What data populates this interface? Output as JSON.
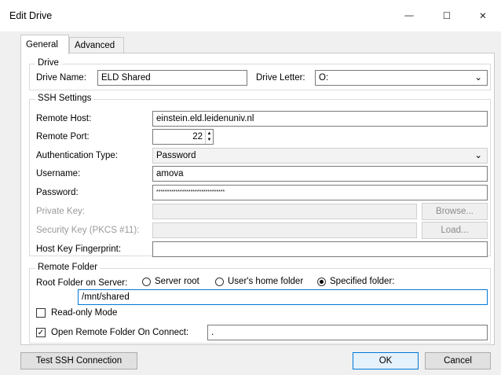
{
  "window": {
    "title": "Edit Drive",
    "minimize": "—",
    "maximize": "☐",
    "close": "✕"
  },
  "tabs": [
    {
      "label": "General"
    },
    {
      "label": "Advanced"
    }
  ],
  "drive": {
    "group_label": "Drive",
    "name_label": "Drive Name:",
    "name_value": "ELD Shared",
    "letter_label": "Drive Letter:",
    "letter_value": "O:"
  },
  "ssh": {
    "group_label": "SSH Settings",
    "host_label": "Remote Host:",
    "host_value": "einstein.eld.leidenuniv.nl",
    "port_label": "Remote Port:",
    "port_value": "22",
    "auth_label": "Authentication Type:",
    "auth_value": "Password",
    "user_label": "Username:",
    "user_value": "amova",
    "password_label": "Password:",
    "password_value": "********************************",
    "private_key_label": "Private Key:",
    "private_key_value": "",
    "browse_label": "Browse...",
    "security_key_label": "Security Key (PKCS #11):",
    "security_key_value": "",
    "load_label": "Load...",
    "fingerprint_label": "Host Key Fingerprint:",
    "fingerprint_value": ""
  },
  "remote_folder": {
    "group_label": "Remote Folder",
    "root_label": "Root Folder on Server:",
    "options": [
      {
        "label": "Server root",
        "selected": false
      },
      {
        "label": "User's home folder",
        "selected": false
      },
      {
        "label": "Specified folder:",
        "selected": true
      }
    ],
    "path_value": "/mnt/shared",
    "readonly_label": "Read-only Mode",
    "readonly_checked": false,
    "open_on_connect_label": "Open Remote Folder On Connect:",
    "open_on_connect_checked": true,
    "open_on_connect_value": "."
  },
  "buttons": {
    "test": "Test SSH Connection",
    "ok": "OK",
    "cancel": "Cancel"
  },
  "colors": {
    "focus_border": "#0078d7",
    "background": "#f0f0f0"
  }
}
